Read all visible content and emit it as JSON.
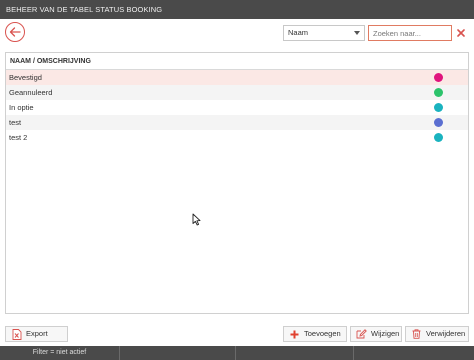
{
  "window": {
    "title": "BEHEER VAN DE TABEL STATUS BOOKING"
  },
  "toolbar": {
    "filter_field": "Naam",
    "search_placeholder": "Zoeken naar..."
  },
  "grid": {
    "header": "NAAM / OMSCHRIJVING",
    "rows": [
      {
        "label": "Bevestigd",
        "color": "#e0137d"
      },
      {
        "label": "Geannuleerd",
        "color": "#2cc36b"
      },
      {
        "label": "In optie",
        "color": "#1ab3bf"
      },
      {
        "label": "test",
        "color": "#5b6fd1"
      },
      {
        "label": "test 2",
        "color": "#1ab3bf"
      }
    ]
  },
  "buttons": {
    "export": "Export",
    "add": "Toevoegen",
    "edit": "Wijzigen",
    "delete": "Verwijderen"
  },
  "status": {
    "filter": "Filter = niet actief"
  },
  "colors": {
    "accent": "#d9534f",
    "add_icon": "#e0412f"
  },
  "icons": [
    "back-arrow-icon",
    "chevron-down-icon",
    "clear-icon",
    "excel-export-icon",
    "plus-icon",
    "edit-icon",
    "trash-icon",
    "mouse-cursor-icon"
  ]
}
